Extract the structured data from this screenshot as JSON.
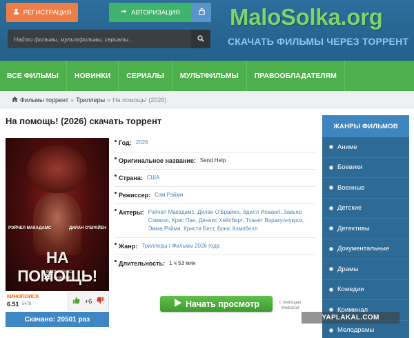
{
  "header": {
    "register_label": "РЕГИСТРАЦИЯ",
    "login_label": "АВТОРИЗАЦИЯ",
    "search_placeholder": "Найти фильмы, мультфильмы, сериалы...",
    "logo": "MaloSolka.org",
    "tagline": "СКАЧАТЬ ФИЛЬМЫ ЧЕРЕЗ ТОРРЕНТ",
    "colors": {
      "bg": "#2c6e9c",
      "register": "#ee7e45",
      "login": "#3fb36b",
      "logo": "#7fd46a"
    }
  },
  "nav": {
    "items": [
      {
        "label": "ВСЕ ФИЛЬМЫ"
      },
      {
        "label": "НОВИНКИ"
      },
      {
        "label": "СЕРИАЛЫ"
      },
      {
        "label": "МУЛЬТФИЛЬМЫ"
      },
      {
        "label": "ПРАВООБЛАДАТЕЛЯМ"
      }
    ],
    "color": "#4db04d"
  },
  "breadcrumb": {
    "home": "Фильмы торрент",
    "sep": "»",
    "section": "Триллеры",
    "current": "На помощь! (2026)"
  },
  "movie": {
    "title": "На помощь! (2026) скачать торрент",
    "poster": {
      "actor_left": "РЭЙЧЕЛ МАКАДАМС",
      "actor_right": "ДИЛАН О'БРАЙЕН",
      "title": "НА ПОМОЩЬ!",
      "release_prefix": "В ФОРМАТЕ 3D",
      "release_day": "29",
      "release_month": "ЯНВАРЯ"
    },
    "fields": {
      "year_label": "Год:",
      "year": "2026",
      "orig_label": "Оригинальное название:",
      "orig": "Send Help",
      "country_label": "Страна:",
      "country": "США",
      "director_label": "Режиссер:",
      "director": "Сэм Рэйми",
      "actors_label": "Актеры:",
      "actors": "Рэйчел Макадамс, Дилан О'Брайен, Эдилл Исмаил, Завьер Сэмюэл, Крис Пан, Деннис Хейсберт, Тханет Варакулнукрох, Эмма Рэйми, Кристи Бест, Брюс Кэмпбелл",
      "genre_label": "Жанр:",
      "genre": "Триллеры / Фильмы 2026 года",
      "duration_label": "Длительность:",
      "duration": "1 ч 53 мин"
    },
    "kinopoisk": {
      "logo": "КИНОПОИСК",
      "score": "6.51",
      "votes": "5478"
    },
    "votes": {
      "up": "+6"
    },
    "downloads": "Скачано: 20501 раз",
    "watch_label": "Начать просмотр",
    "via_line1": "с помощью",
    "via_line2": "MediaGet"
  },
  "sidebar": {
    "title": "ЖАНРЫ ФИЛЬМОВ",
    "items": [
      {
        "label": "Аниме"
      },
      {
        "label": "Боевики"
      },
      {
        "label": "Военные"
      },
      {
        "label": "Детские"
      },
      {
        "label": "Детективы"
      },
      {
        "label": "Документальные"
      },
      {
        "label": "Драмы"
      },
      {
        "label": "Комедии"
      },
      {
        "label": "Криминал"
      },
      {
        "label": "Мелодрамы"
      }
    ]
  },
  "watermark": "YAPLAKAL.COM"
}
